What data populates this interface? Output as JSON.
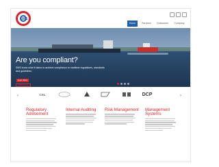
{
  "header": {
    "logo_text": "SMS",
    "social_icons": [
      "twitter-icon",
      "linkedin-icon",
      "facebook-icon"
    ],
    "nav": [
      {
        "label": "Home",
        "active": true
      },
      {
        "label": "Services",
        "active": false
      },
      {
        "label": "Customers",
        "active": false
      },
      {
        "label": "Company",
        "active": false
      }
    ]
  },
  "hero": {
    "title": "Are you compliant?",
    "subtitle": "SMS know what it takes to achieve compliance to maritime regulations, standards and guidelines",
    "button_label": "Learn More",
    "tag_label": "Who we are",
    "slides": 4,
    "active_slide": 1
  },
  "partners": {
    "prev_icon": "chevron-left-icon",
    "next_icon": "chevron-right-icon",
    "items": [
      "CSL",
      "",
      "",
      "",
      "",
      "DCP"
    ]
  },
  "services": [
    {
      "title": "Regulatory Advisement"
    },
    {
      "title": "Internal Auditing"
    },
    {
      "title": "Risk Management"
    },
    {
      "title": "Management Systems"
    }
  ],
  "colors": {
    "brand_red": "#d8262d",
    "brand_blue": "#1f5fa8"
  }
}
